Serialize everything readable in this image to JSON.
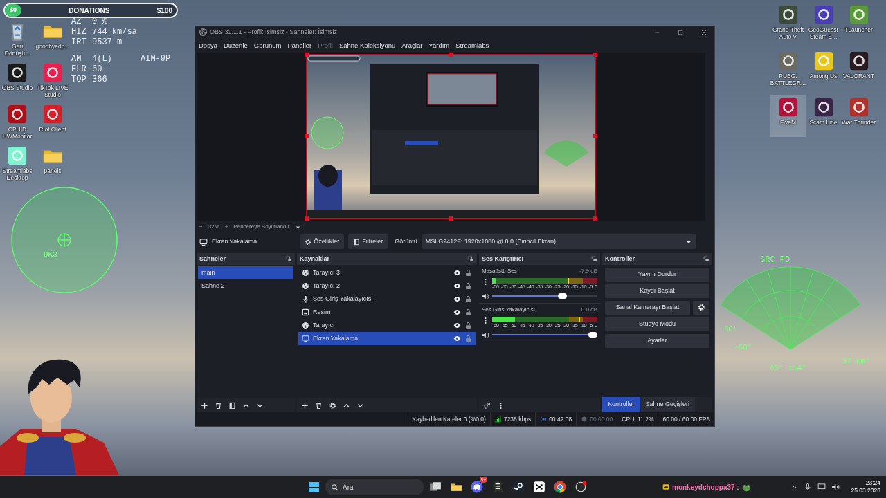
{
  "donation_bar": {
    "current": "$0",
    "title": "DONATIONS",
    "goal": "$100"
  },
  "hud": {
    "groups": [
      [
        {
          "label": "AZ",
          "value": "0 %"
        },
        {
          "label": "HIZ",
          "value": "744 km/sa"
        },
        {
          "label": "IRT",
          "value": "9537 m"
        }
      ],
      [
        {
          "label": "AM",
          "value": "4(L)",
          "extra": "AIM-9P"
        },
        {
          "label": "FLR",
          "value": "60"
        },
        {
          "label": "TOP",
          "value": "366"
        }
      ]
    ]
  },
  "desktop_icons_left": [
    {
      "label": "Geri Dönüşü...",
      "kind": "bin",
      "selected": false
    },
    {
      "label": "goodbyedp...",
      "kind": "folder",
      "selected": false
    },
    {
      "label": "OBS Studio",
      "kind": "tile",
      "color": "#1b1b1b",
      "selected": false
    },
    {
      "label": "TikTok LIVE Studio",
      "kind": "tile",
      "color": "#e8204f",
      "selected": false
    },
    {
      "label": "CPUID HWMonitor",
      "kind": "tile",
      "color": "#b00f1a",
      "selected": false
    },
    {
      "label": "Riot Client",
      "kind": "tile",
      "color": "#d3202a",
      "selected": false
    },
    {
      "label": "Streamlabs Desktop",
      "kind": "tile",
      "color": "#80f5d2",
      "selected": false
    },
    {
      "label": "panels",
      "kind": "folder",
      "selected": false
    }
  ],
  "desktop_icons_right": [
    {
      "label": "Grand Theft Auto V",
      "kind": "tile",
      "color": "#3b4a3a",
      "selected": false
    },
    {
      "label": "GeoGuessr Steam E...",
      "kind": "tile",
      "color": "#4a3fb0",
      "selected": false
    },
    {
      "label": "TLauncher",
      "kind": "tile",
      "color": "#5a9a3a",
      "selected": false
    },
    {
      "label": "PUBG: BATTLEGR...",
      "kind": "tile",
      "color": "#6b6b63",
      "selected": false
    },
    {
      "label": "Among Us",
      "kind": "tile",
      "color": "#e8c820",
      "selected": false
    },
    {
      "label": "VALORANT",
      "kind": "tile",
      "color": "#2a1a22",
      "selected": false
    },
    {
      "label": "FiveM",
      "kind": "tile",
      "color": "#b3123a",
      "selected": true
    },
    {
      "label": "Scam Line",
      "kind": "tile",
      "color": "#3a2448",
      "selected": false
    },
    {
      "label": "War Thunder",
      "kind": "tile",
      "color": "#b0322a",
      "selected": false
    }
  ],
  "radar_left": {
    "label": "9K3"
  },
  "radar_right": {
    "mode": "SRC PD",
    "labels": [
      "60°",
      "-60°",
      "60° x14°",
      "37 km°"
    ]
  },
  "obs": {
    "title": "OBS 31.1.1 - Profil: İsimsiz - Sahneler: İsimsiz",
    "menu": [
      {
        "label": "Dosya",
        "disabled": false
      },
      {
        "label": "Düzenle",
        "disabled": false
      },
      {
        "label": "Görünüm",
        "disabled": false
      },
      {
        "label": "Paneller",
        "disabled": false
      },
      {
        "label": "Profil",
        "disabled": true
      },
      {
        "label": "Sahne Koleksiyonu",
        "disabled": false
      },
      {
        "label": "Araçlar",
        "disabled": false
      },
      {
        "label": "Yardım",
        "disabled": false
      },
      {
        "label": "Streamlabs",
        "disabled": false
      }
    ],
    "preview_zoom": {
      "minus": "−",
      "value": "32%",
      "plus": "+",
      "fit_label": "Pencereye Boyutlandır"
    },
    "source_toolbar": {
      "source": "Ekran Yakalama",
      "properties": "Özellikler",
      "filters": "Filtreler",
      "display_label": "Görüntü",
      "display_value": "MSI G2412F: 1920x1080 @ 0,0 (Birincil Ekran)"
    },
    "scenes": {
      "title": "Sahneler",
      "items": [
        {
          "label": "main",
          "selected": true
        },
        {
          "label": "Sahne 2",
          "selected": false
        }
      ]
    },
    "sources": {
      "title": "Kaynaklar",
      "items": [
        {
          "label": "Tarayıcı 3",
          "kind": "browser",
          "visible": true,
          "locked": false,
          "selected": false
        },
        {
          "label": "Tarayıcı 2",
          "kind": "browser",
          "visible": true,
          "locked": false,
          "selected": false
        },
        {
          "label": "Ses Giriş Yakalayıcısı",
          "kind": "mic",
          "visible": true,
          "locked": false,
          "selected": false
        },
        {
          "label": "Resim",
          "kind": "image",
          "visible": true,
          "locked": false,
          "selected": false
        },
        {
          "label": "Tarayıcı",
          "kind": "browser",
          "visible": true,
          "locked": false,
          "selected": false
        },
        {
          "label": "Ekran Yakalama",
          "kind": "display",
          "visible": true,
          "locked": false,
          "selected": true
        }
      ]
    },
    "mixer": {
      "title": "Ses Karıştırıcı",
      "channels": [
        {
          "name": "Masaüstü Ses",
          "reading": "-7.9 dB",
          "meter": {
            "level": 0.03
          },
          "peak": {
            "level": 0.72
          },
          "scale": [
            "-60",
            "-55",
            "-50",
            "-45",
            "-40",
            "-35",
            "-30",
            "-25",
            "-20",
            "-15",
            "-10",
            "-5",
            "0"
          ],
          "volume": {
            "level": 0.68
          }
        },
        {
          "name": "Ses Giriş Yakalayıcısı",
          "reading": "0.0 dB",
          "meter": {
            "level": 0.22
          },
          "peak": {
            "level": 0.82
          },
          "scale": [
            "-60",
            "-55",
            "-50",
            "-45",
            "-40",
            "-35",
            "-30",
            "-25",
            "-20",
            "-15",
            "-10",
            "-5",
            "0"
          ],
          "volume": {
            "level": 1
          }
        }
      ]
    },
    "controls": {
      "title": "Kontroller",
      "buttons": [
        {
          "label": "Yayını Durdur",
          "settings": false
        },
        {
          "label": "Kaydı Başlat",
          "settings": false
        },
        {
          "label": "Sanal Kamerayı Başlat",
          "settings": true
        },
        {
          "label": "Stüdyo Modu",
          "settings": false
        },
        {
          "label": "Ayarlar",
          "settings": false
        }
      ],
      "tabs": [
        {
          "label": "Kontroller",
          "selected": true
        },
        {
          "label": "Sahne Geçişleri",
          "selected": false
        }
      ]
    },
    "status_bar": {
      "dropped_frames": "Kaybedilen Kareler 0 (%0.0)",
      "bitrate": "7238 kbps",
      "stream_time": "00:42:08",
      "record_time": "00:00:00",
      "cpu": "CPU: 11.2%",
      "fps": "60.00 / 60.00 FPS"
    }
  },
  "taskbar": {
    "search_placeholder": "Ara",
    "discord_badge": "9+",
    "chat": {
      "user": "monkeydchoppa37 :"
    },
    "time": "23:24",
    "date": "25.03.2026"
  }
}
